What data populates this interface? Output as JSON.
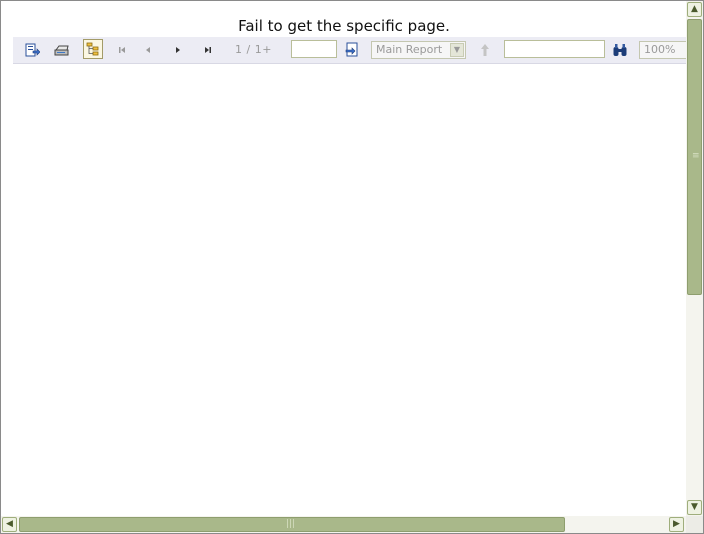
{
  "message": "Fail to get the specific page.",
  "toolbar": {
    "page_info": "1 / 1+",
    "page_input_value": "",
    "report_select": "Main Report",
    "search_input_value": "",
    "zoom": "100%"
  },
  "icons": {
    "export": "export-icon",
    "print": "print-icon",
    "group_tree": "group-tree-icon",
    "first": "first-page-icon",
    "prev": "previous-page-icon",
    "next": "next-page-icon",
    "last": "last-page-icon",
    "goto": "go-to-page-icon",
    "up": "drill-up-icon",
    "search": "binoculars-icon"
  },
  "colors": {
    "toolbar_bg": "#ececf4",
    "scrollbar_thumb": "#a9b88a",
    "scrollbar_border": "#8e9e6e"
  }
}
